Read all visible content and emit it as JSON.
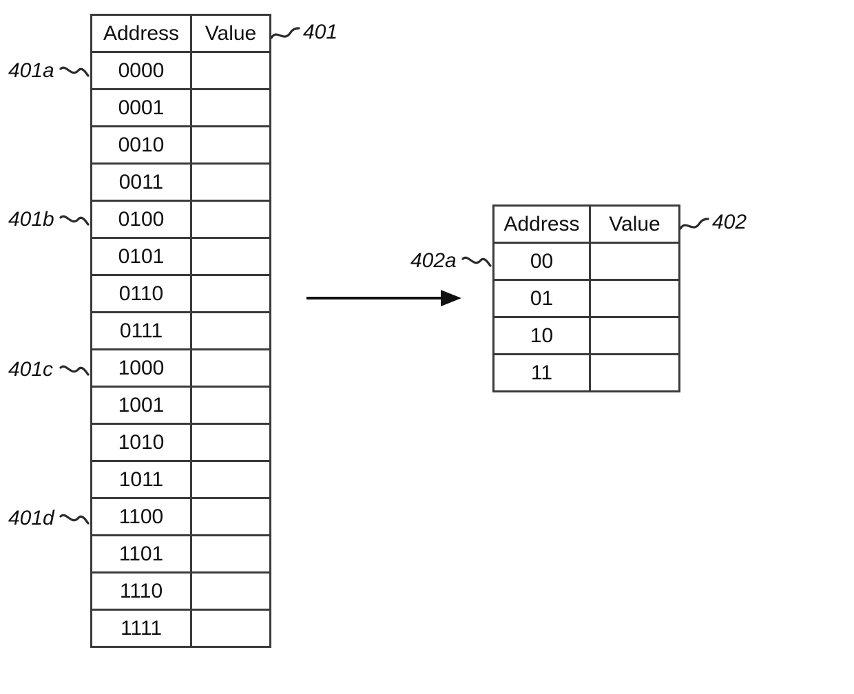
{
  "left_table": {
    "ref_label": "401",
    "headers": {
      "address": "Address",
      "value": "Value"
    },
    "rows": [
      {
        "address": "0000",
        "value": "",
        "callout": "401a"
      },
      {
        "address": "0001",
        "value": ""
      },
      {
        "address": "0010",
        "value": ""
      },
      {
        "address": "0011",
        "value": ""
      },
      {
        "address": "0100",
        "value": "",
        "callout": "401b"
      },
      {
        "address": "0101",
        "value": ""
      },
      {
        "address": "0110",
        "value": ""
      },
      {
        "address": "0111",
        "value": ""
      },
      {
        "address": "1000",
        "value": "",
        "callout": "401c"
      },
      {
        "address": "1001",
        "value": ""
      },
      {
        "address": "1010",
        "value": ""
      },
      {
        "address": "1011",
        "value": ""
      },
      {
        "address": "1100",
        "value": "",
        "callout": "401d"
      },
      {
        "address": "1101",
        "value": ""
      },
      {
        "address": "1110",
        "value": ""
      },
      {
        "address": "1111",
        "value": ""
      }
    ]
  },
  "right_table": {
    "ref_label": "402",
    "headers": {
      "address": "Address",
      "value": "Value"
    },
    "rows": [
      {
        "address": "00",
        "value": "",
        "callout": "402a"
      },
      {
        "address": "01",
        "value": ""
      },
      {
        "address": "10",
        "value": ""
      },
      {
        "address": "11",
        "value": ""
      }
    ]
  },
  "arrow": {
    "from": "left_table",
    "to": "right_table"
  }
}
